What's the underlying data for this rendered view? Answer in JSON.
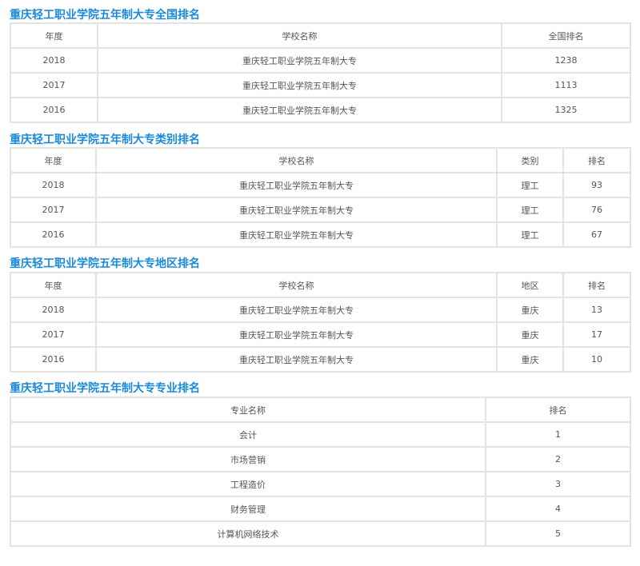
{
  "national": {
    "title": "重庆轻工职业学院五年制大专全国排名",
    "headers": [
      "年度",
      "学校名称",
      "全国排名"
    ],
    "rows": [
      [
        "2018",
        "重庆轻工职业学院五年制大专",
        "1238"
      ],
      [
        "2017",
        "重庆轻工职业学院五年制大专",
        "1113"
      ],
      [
        "2016",
        "重庆轻工职业学院五年制大专",
        "1325"
      ]
    ]
  },
  "category": {
    "title": "重庆轻工职业学院五年制大专类别排名",
    "headers": [
      "年度",
      "学校名称",
      "类别",
      "排名"
    ],
    "rows": [
      [
        "2018",
        "重庆轻工职业学院五年制大专",
        "理工",
        "93"
      ],
      [
        "2017",
        "重庆轻工职业学院五年制大专",
        "理工",
        "76"
      ],
      [
        "2016",
        "重庆轻工职业学院五年制大专",
        "理工",
        "67"
      ]
    ]
  },
  "region": {
    "title": "重庆轻工职业学院五年制大专地区排名",
    "headers": [
      "年度",
      "学校名称",
      "地区",
      "排名"
    ],
    "rows": [
      [
        "2018",
        "重庆轻工职业学院五年制大专",
        "重庆",
        "13"
      ],
      [
        "2017",
        "重庆轻工职业学院五年制大专",
        "重庆",
        "17"
      ],
      [
        "2016",
        "重庆轻工职业学院五年制大专",
        "重庆",
        "10"
      ]
    ]
  },
  "major": {
    "title": "重庆轻工职业学院五年制大专专业排名",
    "headers": [
      "专业名称",
      "排名"
    ],
    "rows": [
      [
        "会计",
        "1"
      ],
      [
        "市场营销",
        "2"
      ],
      [
        "工程造价",
        "3"
      ],
      [
        "财务管理",
        "4"
      ],
      [
        "计算机网络技术",
        "5"
      ]
    ]
  }
}
